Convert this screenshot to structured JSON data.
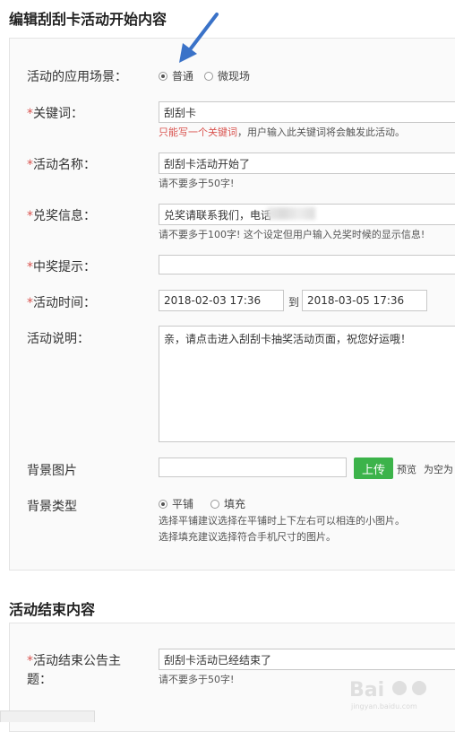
{
  "sections": {
    "start_title": "编辑刮刮卡活动开始内容",
    "end_title": "活动结束内容"
  },
  "required_mark": "*",
  "scene": {
    "label": "活动的应用场景：",
    "options": [
      "普通",
      "微现场"
    ],
    "selected": "普通"
  },
  "keyword": {
    "label": "关键词：",
    "value": "刮刮卡",
    "hint_red": "只能写一个关键词",
    "hint_rest": "，用户输入此关键词将会触发此活动。"
  },
  "name": {
    "label": "活动名称：",
    "value": "刮刮卡活动开始了",
    "hint": "请不要多于50字!"
  },
  "redeem": {
    "label": "兑奖信息：",
    "value": "兑奖请联系我们，电话",
    "hint": "请不要多于100字! 这个设定但用户输入兑奖时候的显示信息!"
  },
  "win_tip": {
    "label": "中奖提示：",
    "value": ""
  },
  "time": {
    "label": "活动时间：",
    "start": "2018-02-03 17:36",
    "to": "到",
    "end": "2018-03-05 17:36"
  },
  "desc": {
    "label": "活动说明：",
    "value": "亲，请点击进入刮刮卡抽奖活动页面，祝您好运哦！"
  },
  "bg_image": {
    "label": "背景图片",
    "value": "",
    "upload": "上传",
    "preview": "预览",
    "note": "为空为"
  },
  "bg_type": {
    "label": "背景类型",
    "options": [
      "平铺",
      "填充"
    ],
    "selected": "平铺",
    "hint1": "选择平铺建议选择在平铺时上下左右可以相连的小图片。",
    "hint2": "选择填充建议选择符合手机尺寸的图片。"
  },
  "end": {
    "label_line1": "活动结束公告主",
    "label_line2": "题：",
    "value": "刮刮卡活动已经结束了",
    "hint": "请不要多于50字!"
  },
  "watermark": {
    "text": "Bai",
    "sub": "jingyan.baidu.com"
  },
  "colors": {
    "required": "#d9534f",
    "upload_button": "#3cb34a",
    "arrow": "#3a72c8"
  }
}
